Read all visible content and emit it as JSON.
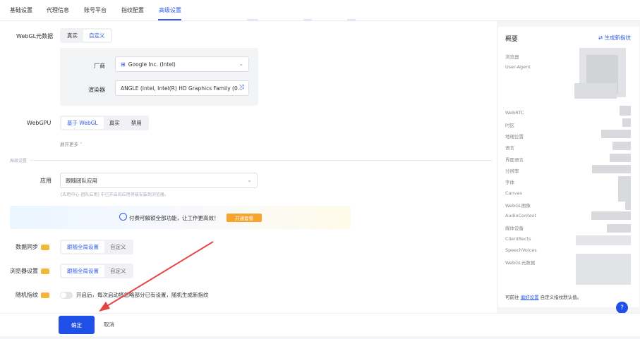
{
  "tabs": [
    {
      "label": "基础设置"
    },
    {
      "label": "代理信息"
    },
    {
      "label": "账号平台"
    },
    {
      "label": "指纹配置"
    },
    {
      "label": "高级设置"
    }
  ],
  "webgl_meta": {
    "label": "WebGL元数据",
    "options": [
      "真实",
      "自定义"
    ],
    "vendor_label": "厂商",
    "vendor_value": "Google Inc. (Intel)",
    "renderer_label": "渲染器",
    "renderer_value": "ANGLE (Intel, Intel(R) HD Graphics Family (0..."
  },
  "webgpu": {
    "label": "WebGPU",
    "options": [
      "基于 WebGL",
      "真实",
      "禁用"
    ]
  },
  "expand_more": "展开更多 ˅",
  "advanced_section": "高级设置",
  "app": {
    "label": "应用",
    "value": "跟随团队应用",
    "hint": "[应用中心-团队应用] 中已开启的应用将被安装到浏览器。"
  },
  "promo": {
    "text": "付费可解锁全部功能，让工作更高效！",
    "button": "开通套餐"
  },
  "data_sync": {
    "label": "数据同步",
    "options": [
      "跟随全局设置",
      "自定义"
    ]
  },
  "browser_settings": {
    "label": "浏览器设置",
    "options": [
      "跟随全局设置",
      "自定义"
    ]
  },
  "random_fp": {
    "label": "随机指纹",
    "desc": "开启后，每次启动将忽略部分已有设置，随机生成新指纹"
  },
  "footer": {
    "ok": "确定",
    "cancel": "取消"
  },
  "summary": {
    "title": "概要",
    "generate": "生成新指纹",
    "rows": [
      "浏览器",
      "User-Agent",
      "WebRTC",
      "时区",
      "地理位置",
      "语言",
      "界面语言",
      "分辨率",
      "字体",
      "Canvas",
      "WebGL图像",
      "AudioContext",
      "媒体设备",
      "ClientRects",
      "SpeechVoices",
      "WebGL元数据"
    ],
    "footer_pre": "可前往",
    "footer_link": "偏好设置",
    "footer_post": "自定义指纹默认值。"
  },
  "colors": {
    "accent": "#2f5be8",
    "primary_button": "#2150e8",
    "promo_button": "#f7a42b",
    "annotation_arrow": "#e64545"
  }
}
